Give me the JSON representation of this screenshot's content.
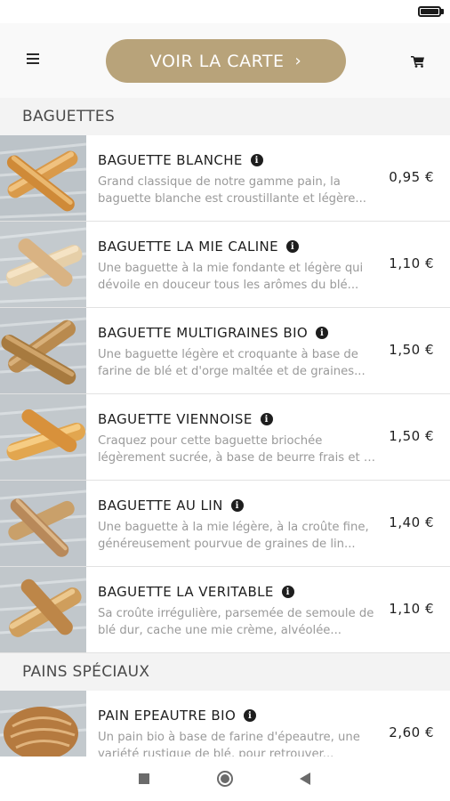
{
  "header": {
    "menu_icon": "hamburger-menu-icon",
    "cta_label": "VOIR LA CARTE",
    "cta_chevron": "›",
    "cart_icon": "cart-icon",
    "accent_color": "#b8a37a"
  },
  "sections": [
    {
      "title": "BAGUETTES",
      "items": [
        {
          "name": "BAGUETTE BLANCHE",
          "desc": "Grand classique de notre gamme pain, la baguette blanche est croustillante et légère...",
          "price": "0,95 €"
        },
        {
          "name": "BAGUETTE LA MIE CALINE",
          "desc": "Une baguette à la mie fondante et légère qui dévoile en douceur tous les arômes du blé...",
          "price": "1,10 €"
        },
        {
          "name": "BAGUETTE MULTIGRAINES BIO",
          "desc": "Une baguette légère et croquante à base de farine de blé et d'orge maltée et de graines...",
          "price": "1,50 €"
        },
        {
          "name": "BAGUETTE VIENNOISE",
          "desc": "Craquez pour cette baguette briochée légèrement sucrée, à base de beurre frais et de lait...",
          "price": "1,50 €"
        },
        {
          "name": "BAGUETTE AU LIN",
          "desc": "Une baguette à la mie légère, à la croûte fine, généreusement pourvue de graines de lin...",
          "price": "1,40 €"
        },
        {
          "name": "BAGUETTE LA VERITABLE",
          "desc": "Sa croûte irrégulière, parsemée de semoule de blé dur, cache une mie crème, alvéolée...",
          "price": "1,10 €"
        }
      ]
    },
    {
      "title": "PAINS SPÉCIAUX",
      "items": [
        {
          "name": "PAIN EPEAUTRE BIO",
          "desc": "Un pain bio à base de farine d'épeautre, une variété rustique de blé, pour retrouver...",
          "price": "2,60 €"
        }
      ]
    }
  ],
  "nav": {
    "recents_icon": "square-recents-icon",
    "home_icon": "circle-home-icon",
    "back_icon": "triangle-back-icon"
  }
}
